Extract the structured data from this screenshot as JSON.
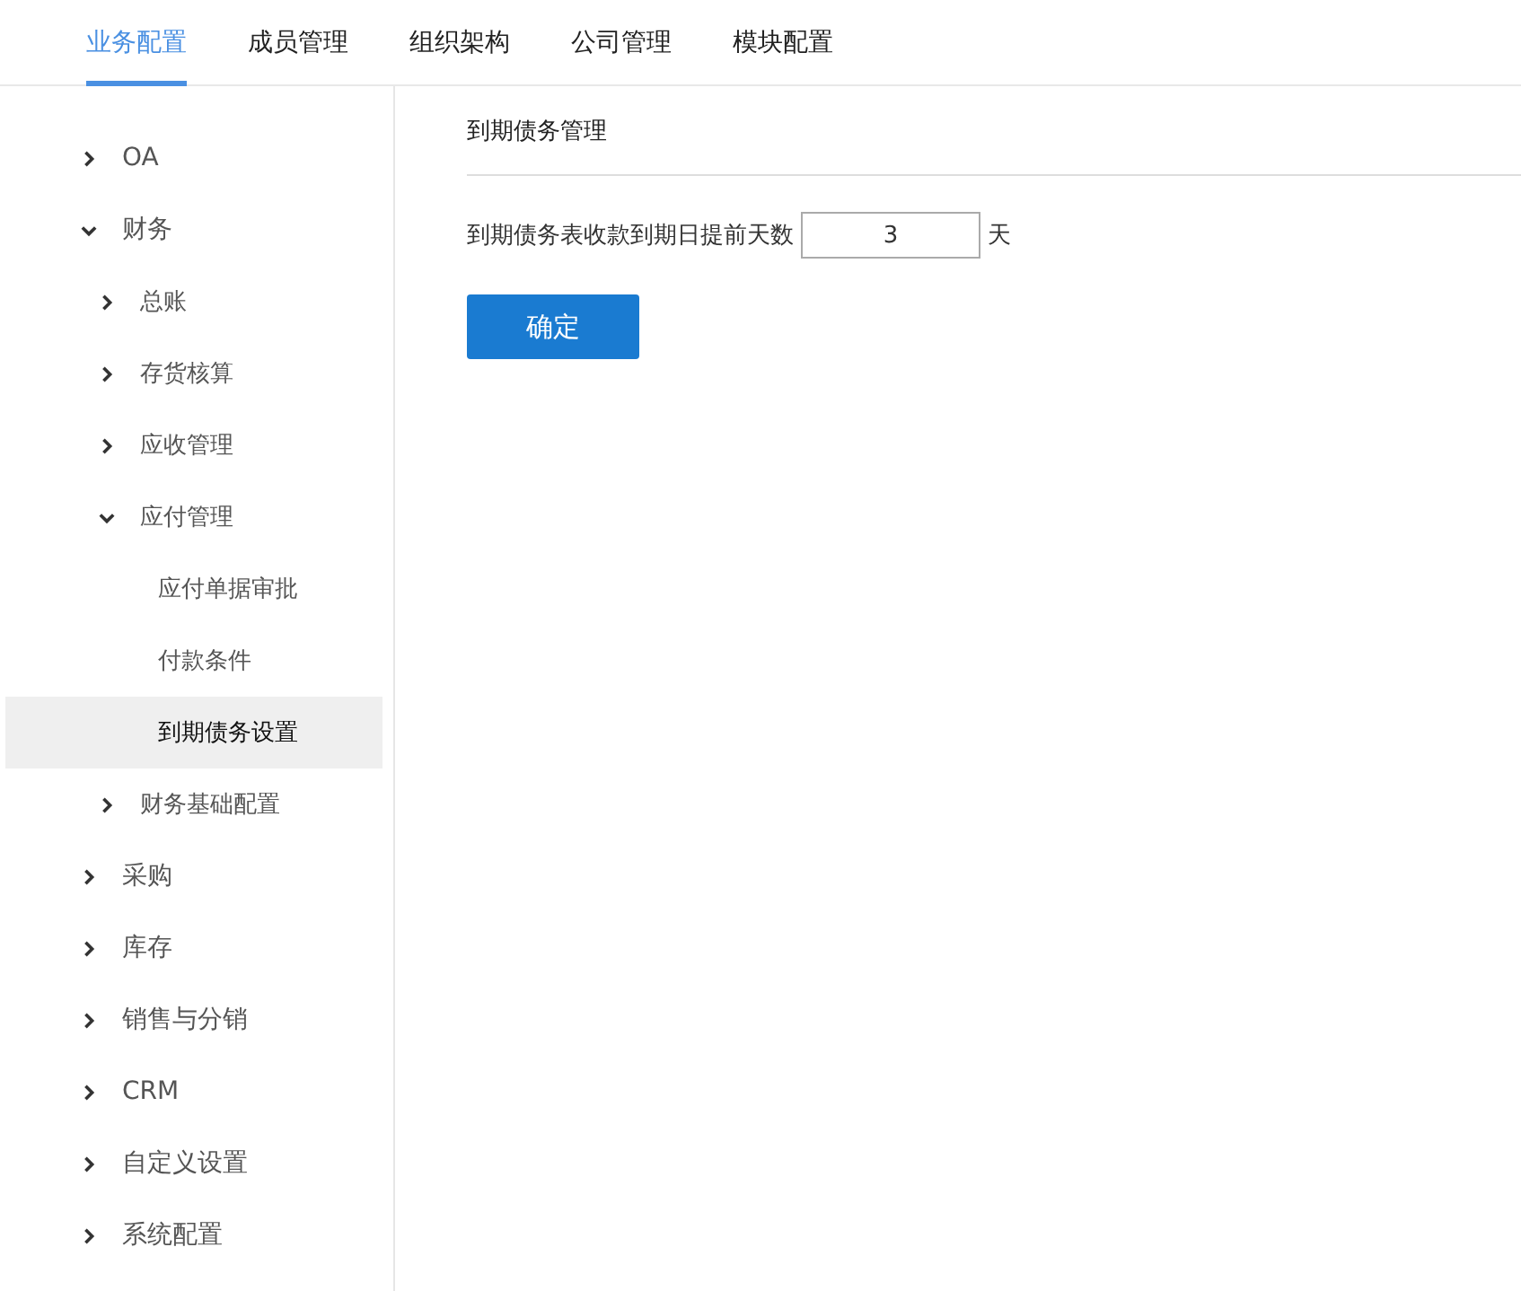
{
  "tabs": [
    {
      "label": "业务配置",
      "selected": true
    },
    {
      "label": "成员管理",
      "selected": false
    },
    {
      "label": "组织架构",
      "selected": false
    },
    {
      "label": "公司管理",
      "selected": false
    },
    {
      "label": "模块配置",
      "selected": false
    }
  ],
  "sidebar": {
    "items": [
      {
        "label": "OA",
        "expanded": false,
        "selected": false
      },
      {
        "label": "财务",
        "expanded": true,
        "selected": false,
        "children": [
          {
            "label": "总账",
            "expanded": false,
            "selected": false
          },
          {
            "label": "存货核算",
            "expanded": false,
            "selected": false
          },
          {
            "label": "应收管理",
            "expanded": false,
            "selected": false
          },
          {
            "label": "应付管理",
            "expanded": true,
            "selected": false,
            "children": [
              {
                "label": "应付单据审批",
                "selected": false
              },
              {
                "label": "付款条件",
                "selected": false
              },
              {
                "label": "到期债务设置",
                "selected": true
              }
            ]
          },
          {
            "label": "财务基础配置",
            "expanded": false,
            "selected": false
          }
        ]
      },
      {
        "label": "采购",
        "expanded": false,
        "selected": false
      },
      {
        "label": "库存",
        "expanded": false,
        "selected": false
      },
      {
        "label": "销售与分销",
        "expanded": false,
        "selected": false
      },
      {
        "label": "CRM",
        "expanded": false,
        "selected": false
      },
      {
        "label": "自定义设置",
        "expanded": false,
        "selected": false
      },
      {
        "label": "系统配置",
        "expanded": false,
        "selected": false
      }
    ]
  },
  "panel": {
    "title": "到期债务管理",
    "field": {
      "label": "到期债务表收款到期日提前天数",
      "value": "3",
      "unit": "天"
    },
    "button": "确定"
  }
}
